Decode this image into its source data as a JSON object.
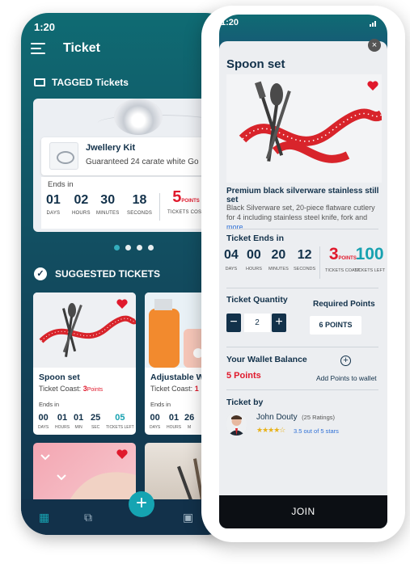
{
  "back": {
    "status_time": "1:20",
    "header_title": "Ticket",
    "tagged_title": "TAGGED Tickets",
    "featured": {
      "name": "Jwellery Kit",
      "desc": "Guaranteed 24 carate white Go",
      "ends_label": "Ends in",
      "days": "01",
      "days_lbl": "DAYS",
      "hours": "02",
      "hours_lbl": "HOURS",
      "minutes": "30",
      "minutes_lbl": "MINUTES",
      "seconds": "18",
      "seconds_lbl": "SECONDS",
      "cost": "5",
      "cost_unit": "POINTS",
      "cost_lbl": "TICKETS COST"
    },
    "carousel_dots": 4,
    "suggested_title": "SUGGESTED TICKETS",
    "cards": [
      {
        "title": "Spoon set",
        "cost_prefix": "Ticket Coast: ",
        "cost": "3",
        "cost_unit": "Points",
        "ends": "Ends in",
        "d": "00",
        "d_lbl": "DAYS",
        "h": "01",
        "h_lbl": "HOURS",
        "m": "01",
        "m_lbl": "MIN",
        "s": "25",
        "s_lbl": "SEC",
        "left": "05",
        "left_lbl": "TICKETS LEFT"
      },
      {
        "title": "Adjustable W",
        "cost_prefix": "Ticket Coast: ",
        "cost": "1",
        "cost_unit": "",
        "ends": "Ends in",
        "d": "00",
        "d_lbl": "DAYS",
        "h": "01",
        "h_lbl": "HOURS",
        "m": "26",
        "m_lbl": "M"
      }
    ],
    "tabbar": {
      "fab": "+"
    }
  },
  "front": {
    "status_time": "1:20",
    "title": "Spoon set",
    "close": "×",
    "product_title": "Premium black silverware stainless still set",
    "product_desc": "Black Silverware set, 20-piece flatware cutlery for 4 including stainless steel knife, fork and ",
    "more": "more ....",
    "ends_title": "Ticket Ends in",
    "days": "04",
    "days_lbl": "DAYS",
    "hours": "00",
    "hours_lbl": "HOURS",
    "minutes": "20",
    "minutes_lbl": "MINUTES",
    "seconds": "12",
    "seconds_lbl": "SECONDS",
    "cost": "3",
    "cost_unit": "POINTS",
    "cost_lbl": "TICKETS COAST",
    "left": "100",
    "left_lbl": "TICKETS LEFT",
    "qty_title": "Ticket Quantity",
    "qty_minus": "−",
    "qty_value": "2",
    "qty_plus": "+",
    "req_title": "Required Points",
    "req_value": "6 POINTS",
    "wallet_title": "Your Wallet Balance",
    "wallet_value": "5 Points",
    "add_points": "Add Points to wallet",
    "by_title": "Ticket by",
    "seller": "John Douty",
    "ratings": "(25 Ratings)",
    "stars": "★★★★☆",
    "stars_text": "3.5 out of 5 stars",
    "join": "JOIN"
  },
  "colors": {
    "navy": "#12314a",
    "teal": "#17a1b0",
    "red": "#e0192c",
    "ribbon": "#d8242b"
  }
}
